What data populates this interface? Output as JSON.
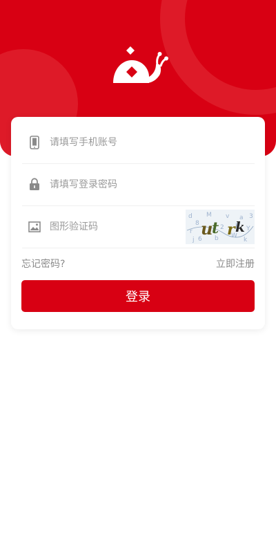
{
  "colors": {
    "brand_red": "#d80013",
    "ring_red": "#de1a28",
    "placeholder": "#9a9a9a",
    "link": "#8a8a8a"
  },
  "header": {
    "logo_icon": "snail-logo-icon"
  },
  "form": {
    "phone": {
      "placeholder": "请填写手机账号",
      "value": "",
      "icon": "phone-icon"
    },
    "password": {
      "placeholder": "请填写登录密码",
      "value": "",
      "icon": "lock-icon"
    },
    "captcha": {
      "placeholder": "图形验证码",
      "value": "",
      "icon": "image-icon",
      "image_icon": "captcha-image"
    }
  },
  "links": {
    "forgot_password": "忘记密码?",
    "register": "立即注册"
  },
  "login_button": "登录"
}
